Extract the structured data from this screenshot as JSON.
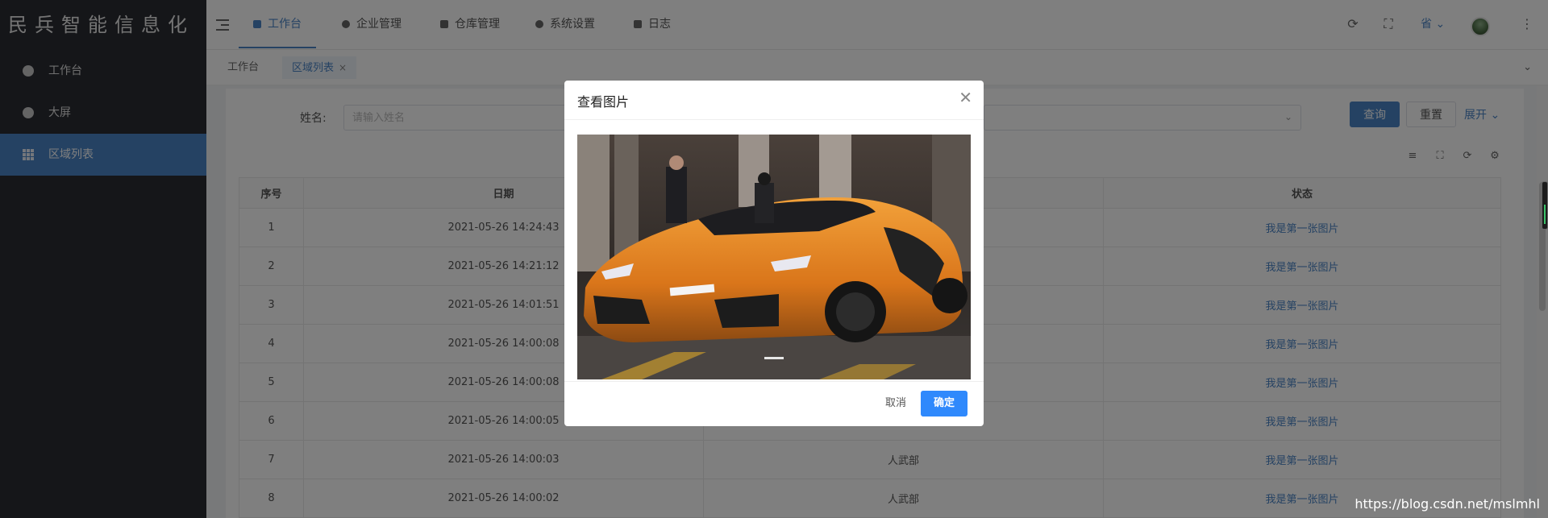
{
  "app": {
    "logo_text": "民兵智能信息化"
  },
  "sidebar": {
    "items": [
      {
        "label": "工作台",
        "icon": "circle-icon",
        "active": false
      },
      {
        "label": "大屏",
        "icon": "circle-icon",
        "active": false
      },
      {
        "label": "区域列表",
        "icon": "grid-icon",
        "active": true
      }
    ]
  },
  "topnav": {
    "tabs": [
      {
        "label": "工作台",
        "icon": "monitor-icon",
        "active": true
      },
      {
        "label": "企业管理",
        "icon": "gear-icon",
        "active": false
      },
      {
        "label": "仓库管理",
        "icon": "home-icon",
        "active": false
      },
      {
        "label": "系统设置",
        "icon": "gear-icon",
        "active": false
      },
      {
        "label": "日志",
        "icon": "document-icon",
        "active": false
      }
    ],
    "lang": "省",
    "right_icons": [
      "refresh-icon",
      "fullscreen-icon",
      "chevron-down-icon",
      "avatar",
      "more-vertical-icon"
    ]
  },
  "tags": {
    "items": [
      {
        "label": "工作台",
        "active": false
      },
      {
        "label": "区域列表",
        "active": true,
        "closable": "×"
      }
    ],
    "more_icon": "chevron-down-icon"
  },
  "search": {
    "name_label": "姓名:",
    "name_placeholder": "请输入姓名",
    "query_label": "查询",
    "reset_label": "重置",
    "expand_label": "展开",
    "select_arrow": "chevron-down-icon"
  },
  "table": {
    "columns": [
      "序号",
      "日期",
      "",
      "状态"
    ],
    "rows": [
      {
        "index": "1",
        "date": "2021-05-26 14:24:43",
        "dept": "",
        "status": "我是第一张图片"
      },
      {
        "index": "2",
        "date": "2021-05-26 14:21:12",
        "dept": "",
        "status": "我是第一张图片"
      },
      {
        "index": "3",
        "date": "2021-05-26 14:01:51",
        "dept": "",
        "status": "我是第一张图片"
      },
      {
        "index": "4",
        "date": "2021-05-26 14:00:08",
        "dept": "",
        "status": "我是第一张图片"
      },
      {
        "index": "5",
        "date": "2021-05-26 14:00:08",
        "dept": "",
        "status": "我是第一张图片"
      },
      {
        "index": "6",
        "date": "2021-05-26 14:00:05",
        "dept": "",
        "status": "我是第一张图片"
      },
      {
        "index": "7",
        "date": "2021-05-26 14:00:03",
        "dept": "人武部",
        "status": "我是第一张图片"
      },
      {
        "index": "8",
        "date": "2021-05-26 14:00:02",
        "dept": "人武部",
        "status": "我是第一张图片"
      }
    ]
  },
  "modal": {
    "title": "查看图片",
    "close_icon": "close-icon",
    "image_subject": "orange-sports-car",
    "cancel_label": "取消",
    "ok_label": "确定"
  },
  "watermark": "https://blog.csdn.net/mslmhl",
  "colors": {
    "accent": "#4b85c7",
    "sidebar_bg": "#2b2d33",
    "modal_ok": "#2f89fc"
  }
}
